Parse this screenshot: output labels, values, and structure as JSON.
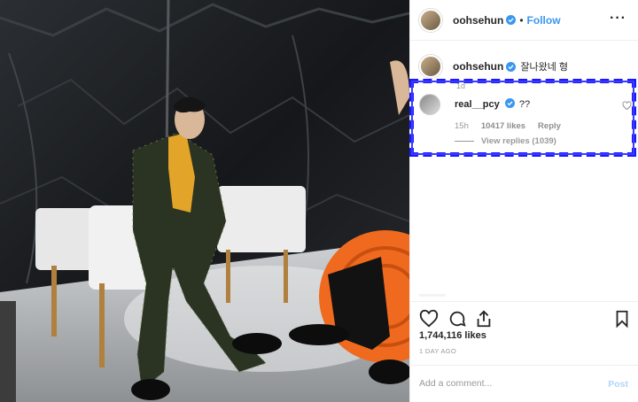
{
  "post": {
    "author": "oohsehun",
    "separator": "•",
    "follow_label": "Follow",
    "more_label": "···",
    "caption_text": "잘나왔네 형",
    "cut_text": "1d",
    "likes": "1,744,116 likes",
    "date": "1 DAY AGO"
  },
  "comment": {
    "user": "real__pcy",
    "text": "??",
    "time": "15h",
    "likes": "10417 likes",
    "reply_label": "Reply",
    "view_replies": "View replies (1039)"
  },
  "add_comment": {
    "placeholder": "Add a comment...",
    "post_label": "Post"
  },
  "colors": {
    "accent": "#3897f0",
    "highlight": "#1a1aff",
    "verified": "#3897f0"
  }
}
